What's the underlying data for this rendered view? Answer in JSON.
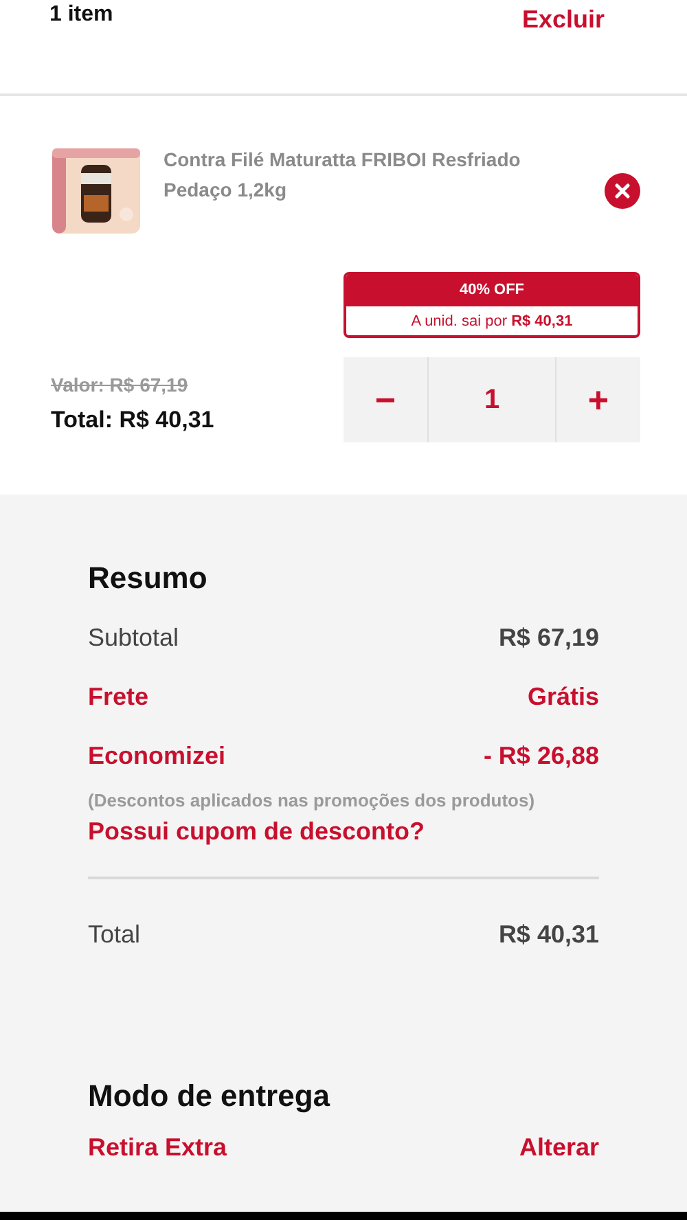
{
  "header": {
    "count": "1 item",
    "action": "Excluir"
  },
  "product": {
    "kind": "picture",
    "name": "Contra Filé Maturatta FRIBOI Resfriado Pedaço 1,2kg",
    "badge": "40% OFF",
    "unit_price_label": "A unid. sai por ",
    "unit_price": "R$ 40,31",
    "old_price": "Valor: R$ 67,19",
    "total": "Total: R$ 40,31",
    "quantity": "1",
    "minus": "−",
    "plus": "+"
  },
  "summary": {
    "title": "Resumo",
    "rows": [
      {
        "label": "Subtotal",
        "value": "R$ 67,19",
        "kind": "plain"
      },
      {
        "label": "Frete",
        "value": "Grátis",
        "kind": "accent"
      },
      {
        "label": "Economizei",
        "value": "- R$ 26,88",
        "kind": "accent"
      }
    ],
    "note": "(Descontos aplicados nas promoções dos produtos)",
    "coupon": "Possui cupom de desconto?",
    "total_label": "Total",
    "total_value": "R$ 40,31"
  },
  "delivery": {
    "title": "Modo de entrega",
    "mode": "Retira Extra",
    "action": "Alterar"
  }
}
